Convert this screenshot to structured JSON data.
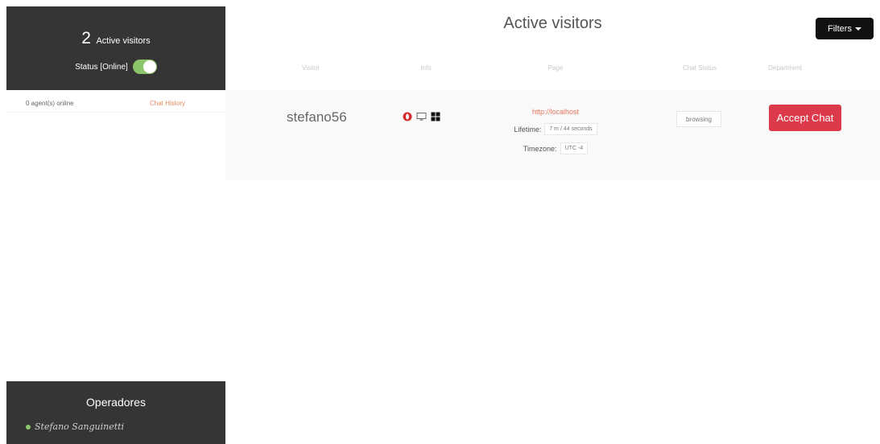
{
  "sidebar": {
    "active_count": "2",
    "active_label": "Active visitors",
    "status_label": "Status [Online]",
    "status_on": true,
    "agents_online": "0 agent(s) online",
    "chat_history": "Chat History"
  },
  "operators": {
    "title": "Operadores",
    "list": [
      {
        "name": "Stefano Sanguinetti",
        "status": "online"
      }
    ]
  },
  "main": {
    "title": "Active visitors",
    "filters_label": "Filters",
    "columns": [
      "Visitor",
      "Info",
      "Page",
      "Chat Status",
      "Department"
    ],
    "visitors": [
      {
        "name": "stefano56",
        "info_icons": [
          "opera-browser-icon",
          "desktop-icon",
          "windows-icon"
        ],
        "page_url": "http://localhost",
        "lifetime_label": "Lifetime:",
        "lifetime_value": "7 m / 44 seconds",
        "timezone_label": "Timezone:",
        "timezone_value": "UTC -4",
        "chat_status": "browsing",
        "action_label": "Accept Chat"
      }
    ]
  },
  "colors": {
    "sidebar_bg": "#353535",
    "accent_red": "#dc3a4a",
    "toggle_green": "#8cc56a",
    "link_orange": "#e6745c"
  }
}
